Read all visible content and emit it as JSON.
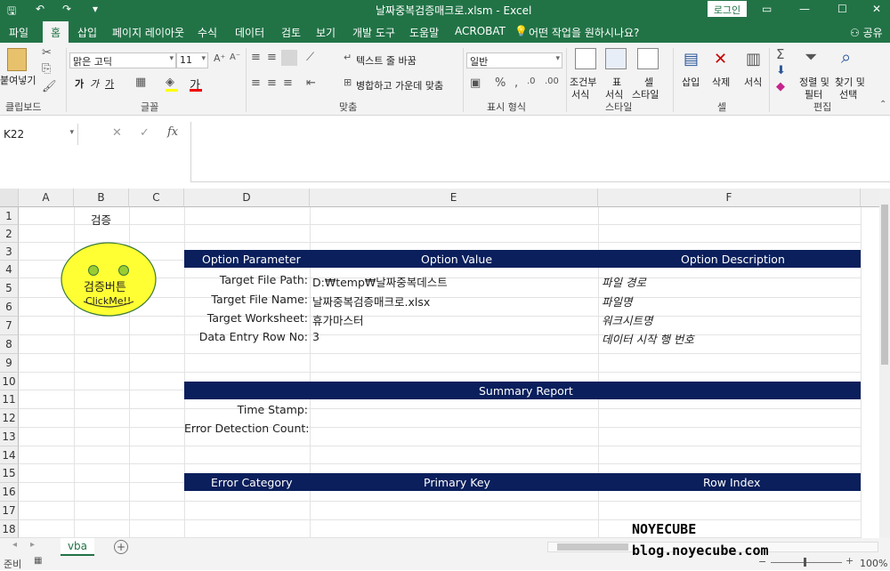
{
  "window": {
    "title": "날짜중복검증매크로.xlsm  -  Excel",
    "login": "로그인"
  },
  "tabs": [
    "파일",
    "홈",
    "삽입",
    "페이지 레이아웃",
    "수식",
    "데이터",
    "검토",
    "보기",
    "개발 도구",
    "도움말",
    "ACROBAT"
  ],
  "tellme": "어떤 작업을 원하시나요?",
  "share": "공유",
  "ribbon": {
    "clipboard": {
      "paste": "붙여넣기",
      "label": "클립보드"
    },
    "font": {
      "name": "맑은 고딕",
      "size": "11",
      "bold": "가",
      "italic": "가",
      "underline": "가",
      "label": "글꼴"
    },
    "align": {
      "wrap": "텍스트 줄 바꿈",
      "merge": "병합하고 가운데 맞춤",
      "label": "맞춤"
    },
    "number": {
      "format": "일반",
      "label": "표시 형식"
    },
    "style": {
      "cond": "조건부",
      "cond2": "서식",
      "table": "표",
      "table2": "서식",
      "cell": "셀",
      "cell2": "스타일",
      "label": "스타일"
    },
    "cells": {
      "insert": "삽입",
      "delete": "삭제",
      "format": "서식",
      "label": "셀"
    },
    "edit": {
      "sort": "정렬 및",
      "sort2": "필터",
      "find": "찾기 및",
      "find2": "선택",
      "label": "편집"
    }
  },
  "namebox": "K22",
  "columns": [
    "A",
    "B",
    "C",
    "D",
    "E",
    "F"
  ],
  "rows": [
    "1",
    "2",
    "3",
    "4",
    "5",
    "6",
    "7",
    "8",
    "9",
    "10",
    "11",
    "12",
    "13",
    "14",
    "15",
    "16",
    "17",
    "18"
  ],
  "sheet": {
    "b1": "검증",
    "button": {
      "line1": "검증버튼",
      "line2": "ClickMe!!"
    },
    "option_header": {
      "param": "Option Parameter",
      "value": "Option Value",
      "desc": "Option Description"
    },
    "options": [
      {
        "param": "Target File Path:",
        "value": "D:₩temp₩날짜중복데스트",
        "desc": "파일 경로"
      },
      {
        "param": "Target File Name:",
        "value": "날짜중복검증매크로.xlsx",
        "desc": "파일명"
      },
      {
        "param": "Target Worksheet:",
        "value": "휴가마스터",
        "desc": "워크시트명"
      },
      {
        "param": "Data Entry Row No:",
        "value": "3",
        "desc": "데이터 시작 행 번호"
      }
    ],
    "summary": {
      "title": "Summary Report",
      "timestamp": "Time Stamp:",
      "errcount": "Error Detection Count:"
    },
    "error_header": {
      "cat": "Error Category",
      "key": "Primary Key",
      "row": "Row Index"
    }
  },
  "sheet_tab": "vba",
  "status": {
    "ready": "준비",
    "zoom": "100%"
  },
  "watermark": {
    "line1": "NOYECUBE",
    "line2": "blog.noyecube.com"
  }
}
